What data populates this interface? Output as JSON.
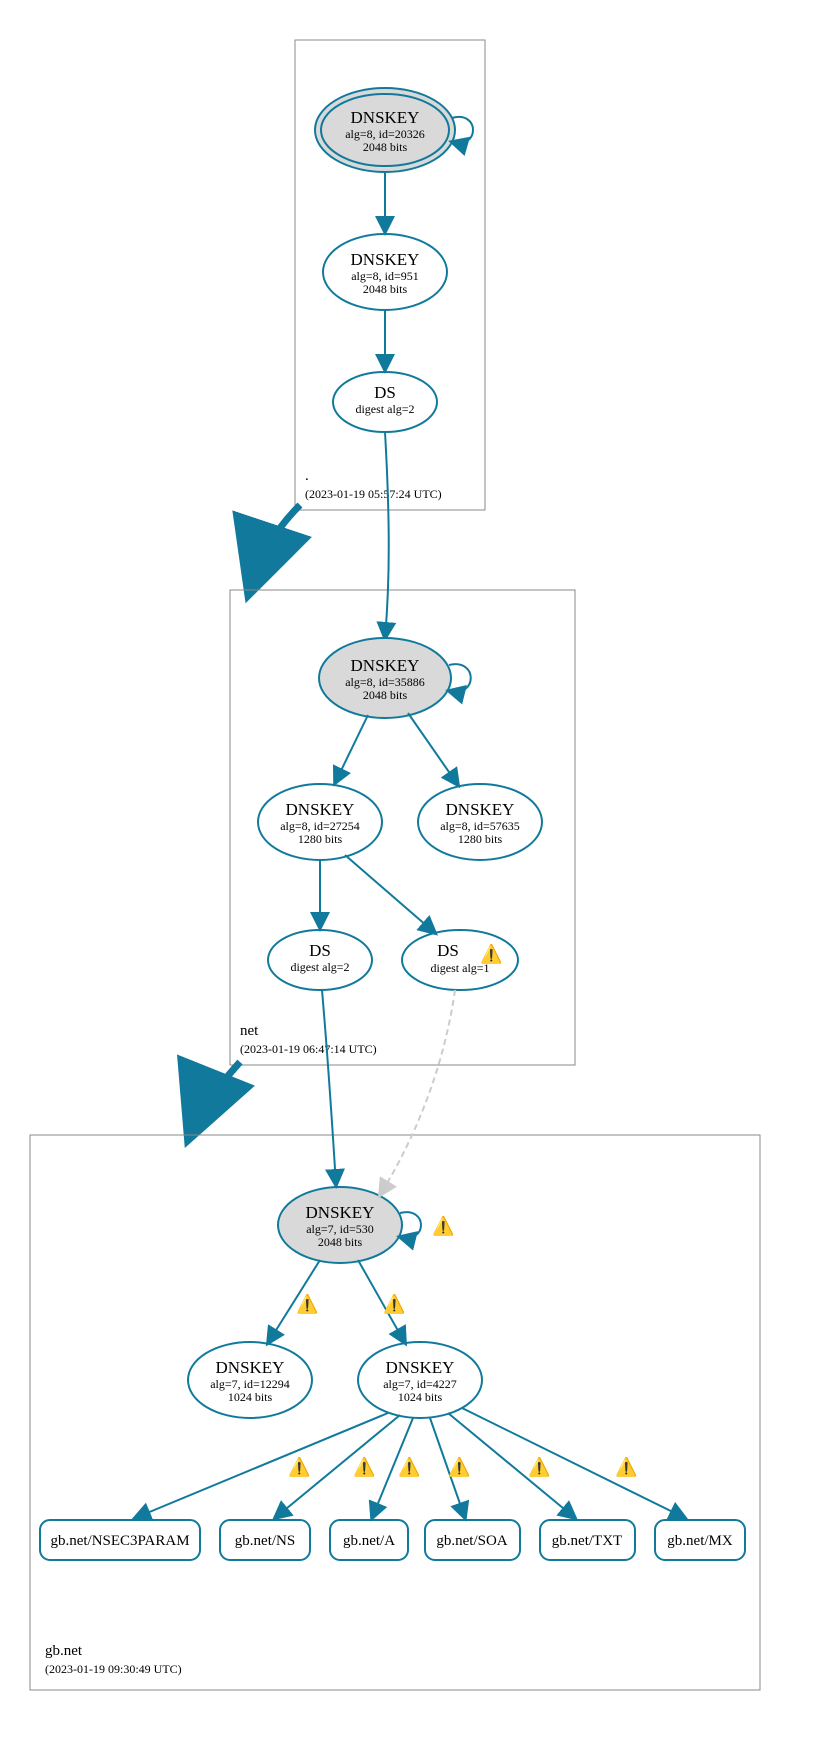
{
  "zones": {
    "root": {
      "label": ".",
      "timestamp": "(2023-01-19 05:57:24 UTC)"
    },
    "net": {
      "label": "net",
      "timestamp": "(2023-01-19 06:47:14 UTC)"
    },
    "gbnet": {
      "label": "gb.net",
      "timestamp": "(2023-01-19 09:30:49 UTC)"
    }
  },
  "nodes": {
    "root_ksk": {
      "title": "DNSKEY",
      "sub1": "alg=8, id=20326",
      "sub2": "2048 bits"
    },
    "root_zsk": {
      "title": "DNSKEY",
      "sub1": "alg=8, id=951",
      "sub2": "2048 bits"
    },
    "root_ds": {
      "title": "DS",
      "sub1": "digest alg=2"
    },
    "net_ksk": {
      "title": "DNSKEY",
      "sub1": "alg=8, id=35886",
      "sub2": "2048 bits"
    },
    "net_zsk1": {
      "title": "DNSKEY",
      "sub1": "alg=8, id=27254",
      "sub2": "1280 bits"
    },
    "net_zsk2": {
      "title": "DNSKEY",
      "sub1": "alg=8, id=57635",
      "sub2": "1280 bits"
    },
    "net_ds1": {
      "title": "DS",
      "sub1": "digest alg=2"
    },
    "net_ds2": {
      "title": "DS",
      "sub1": "digest alg=1"
    },
    "gb_ksk": {
      "title": "DNSKEY",
      "sub1": "alg=7, id=530",
      "sub2": "2048 bits"
    },
    "gb_zsk1": {
      "title": "DNSKEY",
      "sub1": "alg=7, id=12294",
      "sub2": "1024 bits"
    },
    "gb_zsk2": {
      "title": "DNSKEY",
      "sub1": "alg=7, id=4227",
      "sub2": "1024 bits"
    },
    "rr_nsec3": {
      "label": "gb.net/NSEC3PARAM"
    },
    "rr_ns": {
      "label": "gb.net/NS"
    },
    "rr_a": {
      "label": "gb.net/A"
    },
    "rr_soa": {
      "label": "gb.net/SOA"
    },
    "rr_txt": {
      "label": "gb.net/TXT"
    },
    "rr_mx": {
      "label": "gb.net/MX"
    }
  },
  "warn_glyph": "⚠️"
}
